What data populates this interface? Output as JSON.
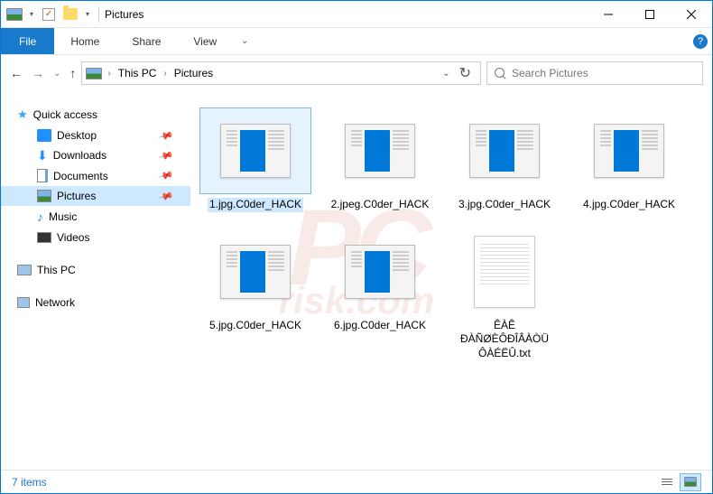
{
  "title": "Pictures",
  "ribbon": {
    "file": "File",
    "tabs": [
      "Home",
      "Share",
      "View"
    ]
  },
  "breadcrumb": {
    "root": "This PC",
    "folder": "Pictures"
  },
  "search": {
    "placeholder": "Search Pictures"
  },
  "sidebar": {
    "quick": "Quick access",
    "items": [
      {
        "label": "Desktop"
      },
      {
        "label": "Downloads"
      },
      {
        "label": "Documents"
      },
      {
        "label": "Pictures"
      },
      {
        "label": "Music"
      },
      {
        "label": "Videos"
      }
    ],
    "thispc": "This PC",
    "network": "Network"
  },
  "files": [
    {
      "name": "1.jpg.C0der_HACK",
      "type": "img",
      "selected": true
    },
    {
      "name": "2.jpeg.C0der_HACK",
      "type": "img"
    },
    {
      "name": "3.jpg.C0der_HACK",
      "type": "img"
    },
    {
      "name": "4.jpg.C0der_HACK",
      "type": "img"
    },
    {
      "name": "5.jpg.C0der_HACK",
      "type": "img"
    },
    {
      "name": "6.jpg.C0der_HACK",
      "type": "img"
    },
    {
      "name": "ÊÀÊ ÐÀÑØÈÔÐÎÂÀÒÜ ÔÀÉËÛ.txt",
      "type": "txt"
    }
  ],
  "status": {
    "count": "7 items"
  },
  "watermark": {
    "main": "PC",
    "sub": "risk.com"
  }
}
